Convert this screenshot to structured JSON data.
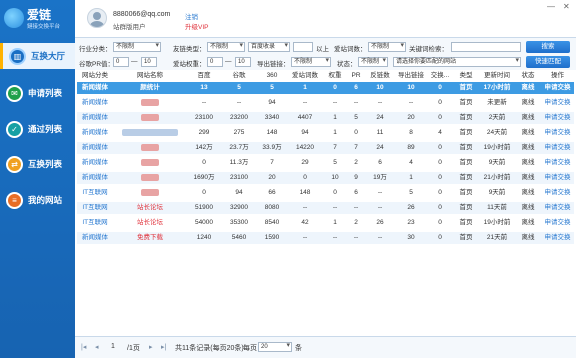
{
  "app": {
    "name": "爱链",
    "tagline": "鏈接交換平台"
  },
  "user": {
    "email": "8880066@qq.com",
    "level": "站群版用户",
    "logout": "注销",
    "upgrade": "升级VIP"
  },
  "window": {
    "min": "—",
    "close": "✕"
  },
  "nav": [
    {
      "label": "互换大厅",
      "icon": "building-icon",
      "glyph": "▥"
    },
    {
      "label": "申请列表",
      "icon": "chat-icon",
      "glyph": "✉"
    },
    {
      "label": "通过列表",
      "icon": "check-list-icon",
      "glyph": "✓"
    },
    {
      "label": "互换列表",
      "icon": "exchange-icon",
      "glyph": "⇄"
    },
    {
      "label": "我的网站",
      "icon": "stack-icon",
      "glyph": "≡"
    }
  ],
  "filters": {
    "industry_label": "行业分类：",
    "industry_value": "不限制",
    "linktype_label": "友链类型：",
    "linktype_value": "不限制",
    "baidu_value": "百度收录",
    "above": "以上",
    "aizhan_label": "爱站词数：",
    "aizhan_value": "不限制",
    "keyword_label": "关键词检索：",
    "keyword_value": "",
    "search_button": "搜索",
    "google_pr_label": "谷歌PR值：",
    "google_pr_from": "0",
    "google_pr_to": "10",
    "range_sep": "—",
    "aizhan_weight_label": "爱站权重：",
    "aizhan_weight_from": "0",
    "aizhan_weight_to": "10",
    "outlinks_label": "导出链接：",
    "outlinks_value": "不限制",
    "status_label": "状态：",
    "status_value": "不限制",
    "match_value": "请选择你要匹配的网站",
    "quick_match_button": "快速匹配"
  },
  "table": {
    "headers": [
      "网站分类",
      "网站名称",
      "百度",
      "谷歌",
      "360",
      "爱站词数",
      "权重",
      "PR",
      "反链数",
      "导出链接",
      "交换...",
      "类型",
      "更新时间",
      "状态",
      "操作"
    ],
    "rows": [
      {
        "cat": "新闻媒体",
        "name": "颜统计",
        "blur": "",
        "baidu": "13",
        "google": "5",
        "s360": "5",
        "words": "1",
        "weight": "0",
        "pr": "6",
        "back": "10",
        "out": "10",
        "ex": "0",
        "type": "首页",
        "time": "17小时前",
        "status": "离线",
        "op": "申请交换"
      },
      {
        "cat": "新闻媒体",
        "name": "",
        "blur": "#e8a3a3",
        "baidu": "--",
        "google": "--",
        "s360": "94",
        "words": "--",
        "weight": "--",
        "pr": "--",
        "back": "--",
        "out": "--",
        "ex": "0",
        "type": "首页",
        "time": "未更新",
        "status": "离线",
        "op": "申请交换"
      },
      {
        "cat": "新闻媒体",
        "name": "",
        "blur": "#e8a3a3",
        "baidu": "23100",
        "google": "23200",
        "s360": "3340",
        "words": "4407",
        "weight": "1",
        "pr": "5",
        "back": "24",
        "out": "20",
        "ex": "0",
        "type": "首页",
        "time": "2天前",
        "status": "离线",
        "op": "申请交换"
      },
      {
        "cat": "新闻媒体",
        "name": "",
        "blur": "#b9cde6",
        "baidu": "299",
        "google": "275",
        "s360": "148",
        "words": "94",
        "weight": "1",
        "pr": "0",
        "back": "11",
        "out": "8",
        "ex": "4",
        "type": "首页",
        "time": "24天前",
        "status": "离线",
        "op": "申请交换"
      },
      {
        "cat": "新闻媒体",
        "name": "",
        "blur": "#e8a3a3",
        "baidu": "142万",
        "google": "23.7万",
        "s360": "33.9万",
        "words": "14220",
        "weight": "7",
        "pr": "7",
        "back": "24",
        "out": "89",
        "ex": "0",
        "type": "首页",
        "time": "19小时前",
        "status": "离线",
        "op": "申请交换"
      },
      {
        "cat": "新闻媒体",
        "name": "",
        "blur": "#e8a3a3",
        "baidu": "0",
        "google": "11.3万",
        "s360": "7",
        "words": "29",
        "weight": "5",
        "pr": "2",
        "back": "6",
        "out": "4",
        "ex": "0",
        "type": "首页",
        "time": "9天前",
        "status": "离线",
        "op": "申请交换"
      },
      {
        "cat": "新闻媒体",
        "name": "",
        "blur": "#e8a3a3",
        "baidu": "1690万",
        "google": "23100",
        "s360": "20",
        "words": "0",
        "weight": "10",
        "pr": "9",
        "back": "19万",
        "out": "1",
        "ex": "0",
        "type": "首页",
        "time": "21小时前",
        "status": "离线",
        "op": "申请交换"
      },
      {
        "cat": "IT互联网",
        "name": "",
        "blur": "#e8a3a3",
        "baidu": "0",
        "google": "94",
        "s360": "66",
        "words": "148",
        "weight": "0",
        "pr": "6",
        "back": "--",
        "out": "5",
        "ex": "0",
        "type": "首页",
        "time": "9天前",
        "status": "离线",
        "op": "申请交换"
      },
      {
        "cat": "IT互联网",
        "name": "站长论坛",
        "blur": "",
        "baidu": "51900",
        "google": "32900",
        "s360": "8080",
        "words": "--",
        "weight": "--",
        "pr": "--",
        "back": "--",
        "out": "26",
        "ex": "0",
        "type": "首页",
        "time": "11天前",
        "status": "离线",
        "op": "申请交换"
      },
      {
        "cat": "IT互联网",
        "name": "站长论坛",
        "blur": "",
        "baidu": "54000",
        "google": "35300",
        "s360": "8540",
        "words": "42",
        "weight": "1",
        "pr": "2",
        "back": "26",
        "out": "23",
        "ex": "0",
        "type": "首页",
        "time": "19小时前",
        "status": "离线",
        "op": "申请交换"
      },
      {
        "cat": "新闻媒体",
        "name": "免费下载",
        "blur": "",
        "baidu": "1240",
        "google": "5460",
        "s360": "1590",
        "words": "--",
        "weight": "--",
        "pr": "--",
        "back": "--",
        "out": "30",
        "ex": "0",
        "type": "首页",
        "time": "21天前",
        "status": "离线",
        "op": "申请交换"
      }
    ]
  },
  "pager": {
    "first": "|◂",
    "prev": "◂",
    "page": "1",
    "total_pages": "/1页",
    "next": "▸",
    "last": "▸|",
    "summary": "共11条记录(每页20条)",
    "per_page_label": "每页",
    "per_page": "20",
    "unit": "条"
  },
  "colors": {
    "sidebar": "#1a73c7",
    "selected_row": "#3d9be3",
    "link": "#2b7bd1",
    "red": "#e0333c"
  }
}
